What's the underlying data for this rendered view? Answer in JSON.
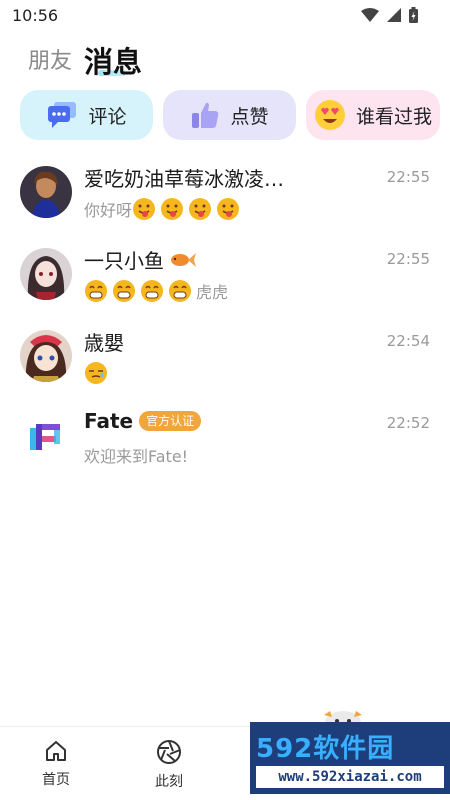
{
  "status_bar": {
    "time": "10:56"
  },
  "header": {
    "tab_friends": "朋友",
    "tab_messages": "消息"
  },
  "cards": {
    "comment": "评论",
    "like": "点赞",
    "viewers": "谁看过我"
  },
  "messages": [
    {
      "name": "爱吃奶油草莓冰激凌…",
      "time": "22:55",
      "preview": "你好呀",
      "emoji_after": [
        "tongue-face-emoji",
        "tongue-face-emoji",
        "tongue-face-emoji",
        "tongue-face-emoji"
      ]
    },
    {
      "name": "一只小鱼",
      "time": "22:55",
      "preview": "虎虎",
      "emoji_before": [
        "grin-emoji",
        "grin-emoji",
        "grin-emoji",
        "grin-emoji"
      ]
    },
    {
      "name": "歳嬰",
      "time": "22:54",
      "preview": "",
      "emoji_after": [
        "sleepy-face-emoji"
      ]
    },
    {
      "name": "Fate",
      "badge": "官方认证",
      "time": "22:52",
      "preview": "欢迎来到Fate!"
    }
  ],
  "bottom_nav": {
    "home": "首页",
    "moment": "此刻"
  },
  "watermark": {
    "main": "592软件园",
    "sub": "www.592xiazai.com"
  },
  "colors": {
    "accent_badge": "#f2a53a",
    "card_comment": "#d6f3fb",
    "card_like": "#e6e4fb",
    "card_viewers": "#fde4ef"
  }
}
